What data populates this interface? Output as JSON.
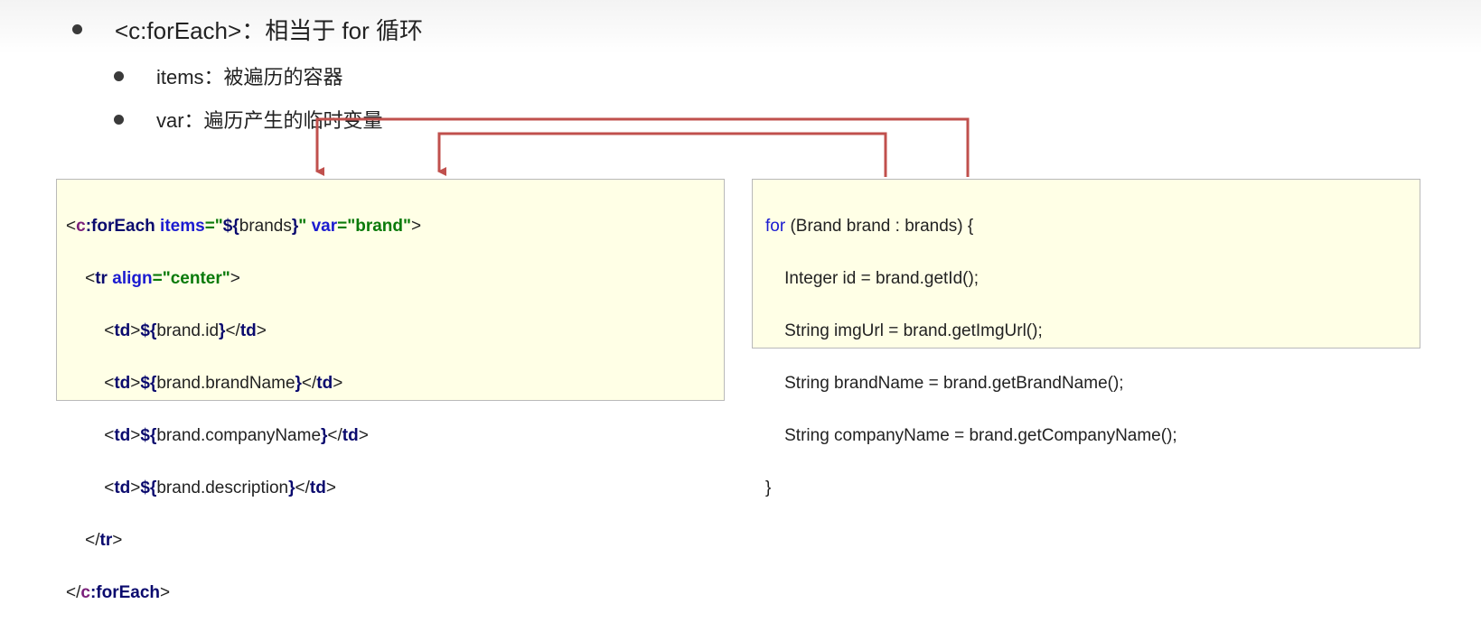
{
  "bullets": {
    "main": "<c:forEach>：相当于 for 循环",
    "items": "items：被遍历的容器",
    "var": "var：遍历产生的临时变量"
  },
  "jsp_code": {
    "l1": [
      "<",
      "c",
      ":",
      "forEach",
      " ",
      "items",
      "=\"",
      "${",
      "brands",
      "}",
      "\"",
      " ",
      "var",
      "=\"brand\"",
      ">"
    ],
    "l2": [
      "<",
      "tr",
      " ",
      "align",
      "=\"center\"",
      ">"
    ],
    "l3": [
      "<",
      "td",
      ">",
      "${",
      "brand.id",
      "}",
      "</",
      "td",
      ">"
    ],
    "l4": [
      "<",
      "td",
      ">",
      "${",
      "brand.brandName",
      "}",
      "</",
      "td",
      ">"
    ],
    "l5": [
      "<",
      "td",
      ">",
      "${",
      "brand.companyName",
      "}",
      "</",
      "td",
      ">"
    ],
    "l6": [
      "<",
      "td",
      ">",
      "${",
      "brand.description",
      "}",
      "</",
      "td",
      ">"
    ],
    "l7": [
      "</",
      "tr",
      ">"
    ],
    "l8": [
      "</",
      "c",
      ":",
      "forEach",
      ">"
    ]
  },
  "java_code": {
    "l1_kw": "for",
    "l1_rest": " (Brand brand : brands) {",
    "l2": "Integer id = brand.getId();",
    "l3": "String imgUrl = brand.getImgUrl();",
    "l4": "String brandName = brand.getBrandName();",
    "l5": "String companyName = brand.getCompanyName();",
    "l6": "}"
  },
  "colors": {
    "arrow": "#c0504d",
    "code_bg": "#ffffe6"
  }
}
